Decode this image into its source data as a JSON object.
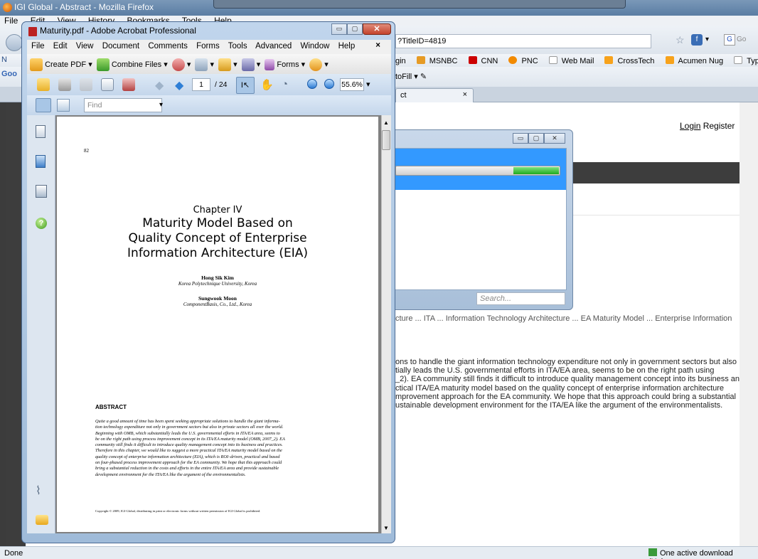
{
  "firefox": {
    "title": "IGI Global - Abstract - Mozilla Firefox",
    "menu": [
      "File",
      "Edit",
      "View",
      "History",
      "Bookmarks",
      "Tools",
      "Help"
    ],
    "url_tail": "?TitleID=4819",
    "search_placeholder": "Go",
    "bookmarks": [
      "gin",
      "MSNBC",
      "CNN",
      "PNC",
      "Web Mail",
      "CrossTech",
      "Acumen Nug",
      "Typefi Publish + RSu"
    ],
    "bookmarks_left": "N",
    "toolbar2_left": "Goo",
    "autofill": "toFill",
    "tab_label": "ct",
    "tab_close": "×",
    "status": "Done",
    "download_status": "One active download (Unkno"
  },
  "page": {
    "login": "Login",
    "register": "Register",
    "keywords": "cture ... ITA ... Information Technology Architecture ... EA Maturity Model ... Enterprise Information",
    "abstract_lines": [
      "ons to handle the giant information technology expenditure not only in government sectors but also",
      "tially leads the U.S. governmental efforts in ITA/EA area, seems to be on the right path using",
      "_2). EA community still finds it difficult to introduce quality management concept into its business and",
      "ctical ITA/EA maturity model based on the quality concept of enterprise information architecture",
      "mprovement approach for the EA community. We hope that this approach could bring a substantial",
      "ustainable development environment for the ITA/EA like the argument of the environmentalists."
    ]
  },
  "download_window": {
    "progress": 0.28,
    "search_placeholder": "Search..."
  },
  "acrobat": {
    "title": "Maturity.pdf - Adobe Acrobat Professional",
    "menu": [
      "File",
      "Edit",
      "View",
      "Document",
      "Comments",
      "Forms",
      "Tools",
      "Advanced",
      "Window",
      "Help"
    ],
    "menu_close": "×",
    "create_pdf": "Create PDF",
    "combine_files": "Combine Files",
    "forms": "Forms",
    "page_current": "1",
    "page_total": "/ 24",
    "zoom": "55.6%",
    "find_placeholder": "Find",
    "nav_icons": [
      "pages-icon",
      "bookmarks-icon",
      "signatures-icon",
      "help-icon",
      "attachments-icon",
      "comments-icon"
    ]
  },
  "pdf": {
    "page_number": "82",
    "chapter": "Chapter IV",
    "title_lines": [
      "Maturity Model Based on",
      "Quality Concept of Enterprise",
      "Information Architecture (EIA)"
    ],
    "author1": "Hong Sik Kim",
    "affil1": "Korea Polytechnique University, Korea",
    "author2": "Sungwook Moon",
    "affil2": "ComponentBasis, Co., Ltd., Korea",
    "abstract_heading": "ABSTRACT",
    "abstract_lines": [
      "Quite a good amount of time has been spent seeking appropriate solutions to handle the giant informa-",
      "tion technology expenditure not only in government sectors but also in private sectors all over the world.",
      "Beginning with OMB, which substantially leads the U.S. governmental efforts in ITA/EA area, seems to",
      "be on the right path using process improvement concept in its ITA/EA maturity model (OMB, 2007_2). EA",
      "community still finds it difficult to introduce quality management concept into its business and practices.",
      "Therefore in this chapter, we would like to suggest a more practical ITA/EA maturity model based on the",
      "quality concept of enterprise information architecture (EIA), which is ROI–driven, practical and based",
      "on four-phased process improvement approach for the EA community. We hope that this approach could",
      "bring a substantial reduction in the costs and efforts in the entire ITA/EA area and provide sustainable",
      "development environment for the ITA/EA like the argument of the environmentalists."
    ],
    "copyright": "Copyright © 2009, IGI Global, distributing in print or electronic forms without written permission of IGI Global is prohibited."
  }
}
